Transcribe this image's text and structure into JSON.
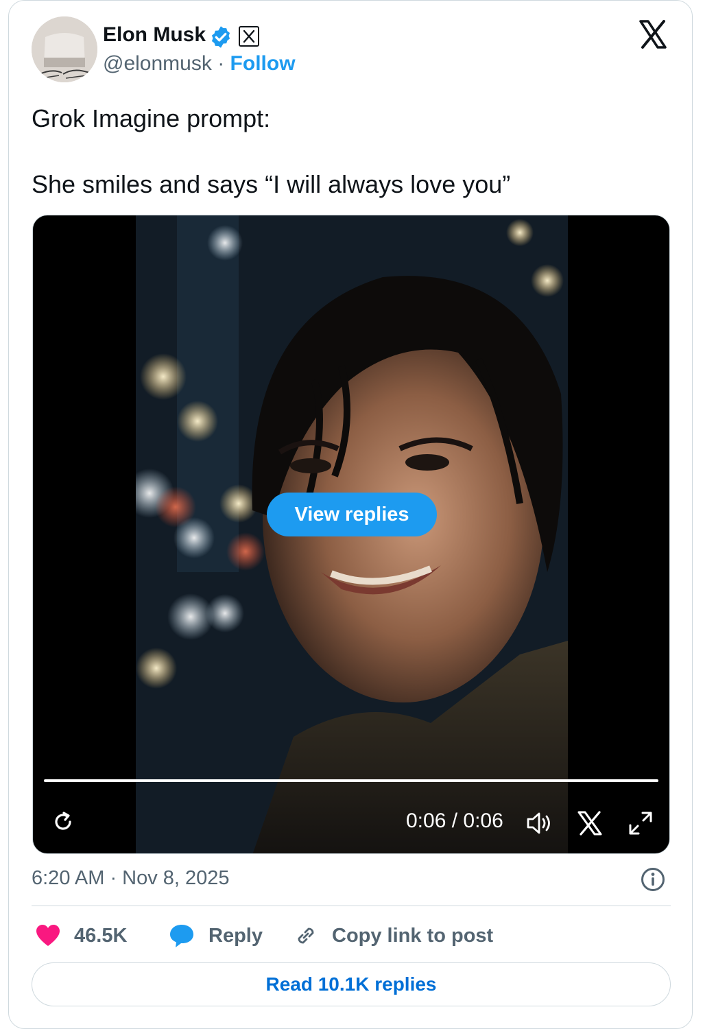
{
  "author": {
    "name": "Elon Musk",
    "handle": "@elonmusk",
    "separator": "·",
    "follow_label": "Follow",
    "verified_color": "#1d9bf0"
  },
  "post": {
    "line1": "Grok Imagine prompt:",
    "line2": "She smiles and says “I will always love you”"
  },
  "video": {
    "overlay_button": "View replies",
    "time": "0:06 / 0:06",
    "progress": 1.0
  },
  "meta": {
    "timestamp": "6:20 AM · Nov 8, 2025"
  },
  "actions": {
    "likes": "46.5K",
    "reply": "Reply",
    "copy_link": "Copy link to post"
  },
  "read_replies": "Read 10.1K replies",
  "icons": [
    "x-logo-icon",
    "verified-badge-icon",
    "affiliate-x-icon",
    "replay-icon",
    "volume-icon",
    "x-watermark-icon",
    "fullscreen-icon",
    "info-icon",
    "heart-icon",
    "reply-bubble-icon",
    "link-icon"
  ],
  "colors": {
    "accent": "#1d9bf0",
    "link": "#006fd6",
    "heart": "#f91880",
    "muted": "#536471"
  }
}
